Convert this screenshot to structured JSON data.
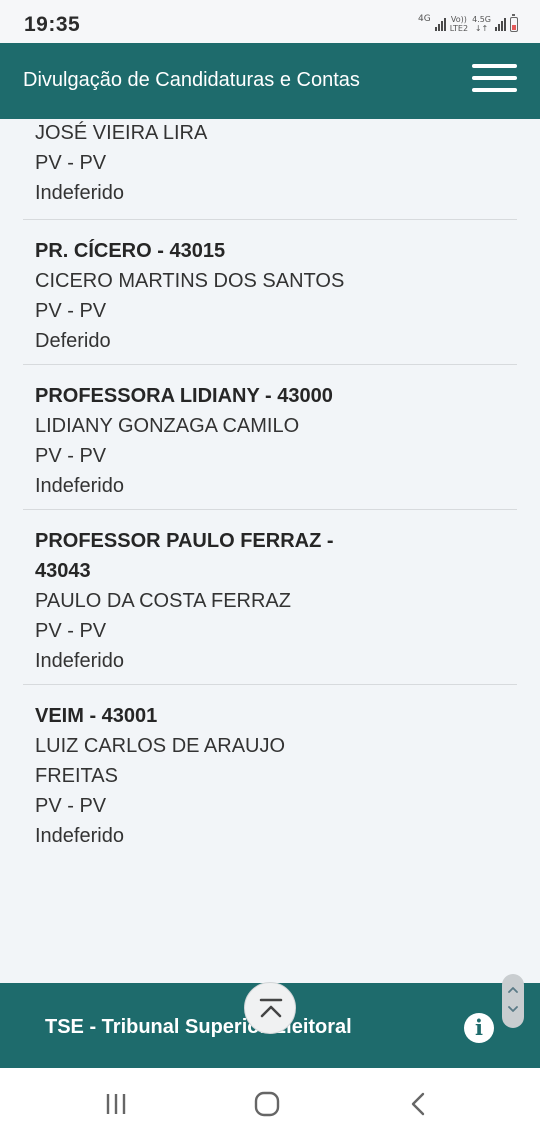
{
  "status_bar": {
    "time": "19:35",
    "network_4g": "4G",
    "volte_top": "Vo))",
    "volte_bottom": "LTE2",
    "speed_top": "4.5G",
    "speed_bottom": "↓↑"
  },
  "header": {
    "title": "Divulgação de Candidaturas e Contas",
    "menu_icon": "hamburger-menu-icon"
  },
  "candidates": [
    {
      "name": "",
      "full_name": "JOSÉ VIEIRA LIRA",
      "party": "PV - PV",
      "status": "Indeferido"
    },
    {
      "name": "PR. CÍCERO - 43015",
      "full_name": "CICERO MARTINS DOS SANTOS",
      "party": "PV - PV",
      "status": "Deferido"
    },
    {
      "name": "PROFESSORA LIDIANY - 43000",
      "full_name": "LIDIANY GONZAGA CAMILO",
      "party": "PV - PV",
      "status": "Indeferido"
    },
    {
      "name": "PROFESSOR PAULO FERRAZ - 43043",
      "full_name": "PAULO DA COSTA FERRAZ",
      "party": "PV - PV",
      "status": "Indeferido"
    },
    {
      "name": "VEIM - 43001",
      "full_name": "LUIZ CARLOS DE ARAUJO FREITAS",
      "party": "PV - PV",
      "status": "Indeferido"
    }
  ],
  "footer": {
    "title": "TSE - Tribunal Superior Eleitoral",
    "info_icon": "info-icon",
    "scroll_top_icon": "chevron-up-to-top-icon"
  },
  "colors": {
    "header_bg": "#1e6b6c",
    "page_bg": "#f2f5f8",
    "divider": "#d7dadd"
  }
}
